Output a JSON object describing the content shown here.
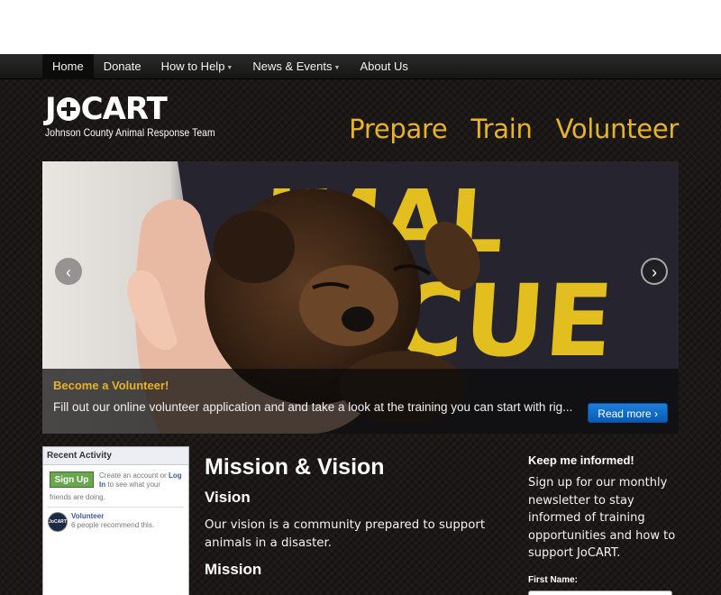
{
  "nav": {
    "items": [
      {
        "label": "Home",
        "dropdown": false,
        "active": true
      },
      {
        "label": "Donate",
        "dropdown": false,
        "active": false
      },
      {
        "label": "How to Help",
        "dropdown": true,
        "active": false
      },
      {
        "label": "News & Events",
        "dropdown": true,
        "active": false
      },
      {
        "label": "About Us",
        "dropdown": false,
        "active": false
      }
    ]
  },
  "logo": {
    "title_left": "J",
    "title_right": "CART",
    "subtitle": "Johnson County Animal Response Team"
  },
  "taglines": [
    "Prepare",
    "Train",
    "Volunteer"
  ],
  "hero": {
    "shirt_text_top": "IMAL",
    "shirt_text_bottom": "CUE",
    "caption_title": "Become a Volunteer!",
    "caption_text": "Fill out our online volunteer application and and take a look at the training you can start with rig...",
    "read_more": "Read more ›",
    "prev_icon": "‹",
    "next_icon": "›"
  },
  "widget": {
    "title": "Recent Activity",
    "signup_label": "Sign Up",
    "note_pre": "Create an account or",
    "note_link": "Log In",
    "note_post": "to see what your",
    "friends_note": "friends are doing.",
    "badge_text": "JoCART",
    "activity_link": "Volunteer",
    "activity_text": "6 people recommend this."
  },
  "main": {
    "heading": "Mission & Vision",
    "vision_heading": "Vision",
    "vision_text": "Our vision is a community prepared to support animals in a disaster.",
    "mission_heading": "Mission"
  },
  "sidebar": {
    "heading": "Keep me informed!",
    "text": "Sign up for our monthly newsletter to stay informed of training opportunities and how to support JoCART.",
    "first_name_label": "First Name:"
  },
  "colors": {
    "accent": "#e8b32a",
    "background": "#1b1815",
    "button_blue": "#0a5ab6",
    "signup_green": "#69a74e"
  }
}
